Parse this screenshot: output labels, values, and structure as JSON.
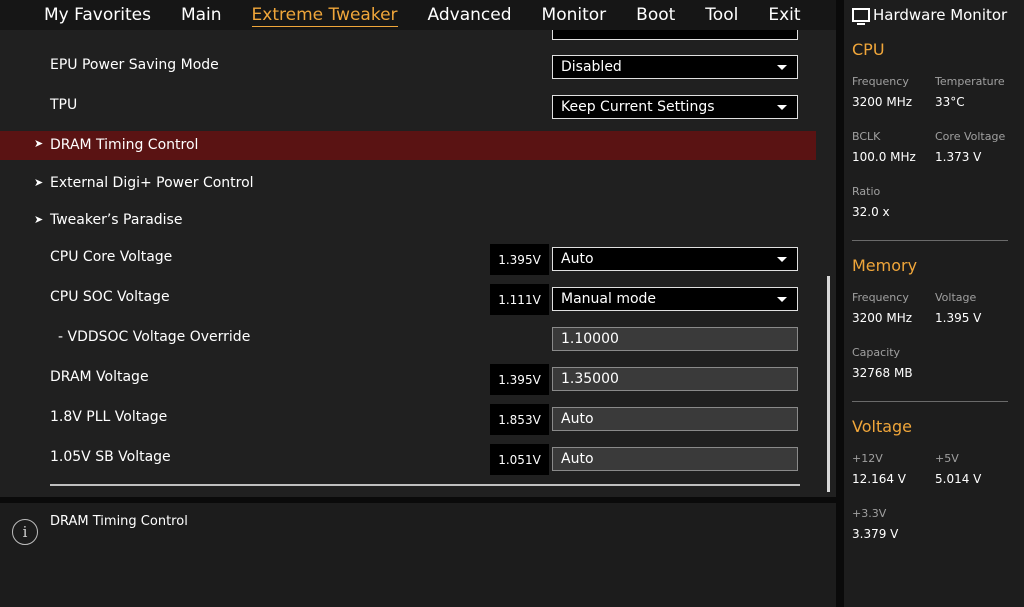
{
  "menu": {
    "tabs": [
      {
        "label": "My Favorites"
      },
      {
        "label": "Main"
      },
      {
        "label": "Extreme Tweaker",
        "active": true
      },
      {
        "label": "Advanced"
      },
      {
        "label": "Monitor"
      },
      {
        "label": "Boot"
      },
      {
        "label": "Tool"
      },
      {
        "label": "Exit"
      }
    ]
  },
  "settings": {
    "epu": {
      "label": "EPU Power Saving Mode",
      "value": "Disabled"
    },
    "tpu": {
      "label": "TPU",
      "value": "Keep Current Settings"
    },
    "dram_timing": {
      "label": "DRAM Timing Control"
    },
    "digi_power": {
      "label": "External Digi+ Power Control"
    },
    "tweakers_paradise": {
      "label": "Tweaker’s Paradise"
    },
    "cpu_core_voltage": {
      "label": "CPU Core Voltage",
      "current": "1.395V",
      "value": "Auto"
    },
    "cpu_soc_voltage": {
      "label": "CPU SOC Voltage",
      "current": "1.111V",
      "value": "Manual mode"
    },
    "vddsoc_override": {
      "label": "- VDDSOC Voltage Override",
      "value": "1.10000"
    },
    "dram_voltage": {
      "label": "DRAM Voltage",
      "current": "1.395V",
      "value": "1.35000"
    },
    "pll_voltage": {
      "label": "1.8V PLL Voltage",
      "current": "1.853V",
      "value": "Auto"
    },
    "sb_voltage": {
      "label": "1.05V SB Voltage",
      "current": "1.051V",
      "value": "Auto"
    }
  },
  "help": {
    "icon": "info-icon",
    "text": "DRAM Timing Control"
  },
  "hardware_monitor": {
    "title": "Hardware Monitor",
    "cpu": {
      "title": "CPU",
      "frequency_label": "Frequency",
      "frequency": "3200 MHz",
      "temperature_label": "Temperature",
      "temperature": "33°C",
      "bclk_label": "BCLK",
      "bclk": "100.0 MHz",
      "core_voltage_label": "Core Voltage",
      "core_voltage": "1.373 V",
      "ratio_label": "Ratio",
      "ratio": "32.0 x"
    },
    "memory": {
      "title": "Memory",
      "frequency_label": "Frequency",
      "frequency": "3200 MHz",
      "voltage_label": "Voltage",
      "voltage": "1.395 V",
      "capacity_label": "Capacity",
      "capacity": "32768 MB"
    },
    "voltage": {
      "title": "Voltage",
      "v12_label": "+12V",
      "v12": "12.164 V",
      "v5_label": "+5V",
      "v5": "5.014 V",
      "v33_label": "+3.3V",
      "v33": "3.379 V"
    }
  },
  "colors": {
    "accent": "#f0a63a",
    "highlight_row": "#5a1313"
  }
}
